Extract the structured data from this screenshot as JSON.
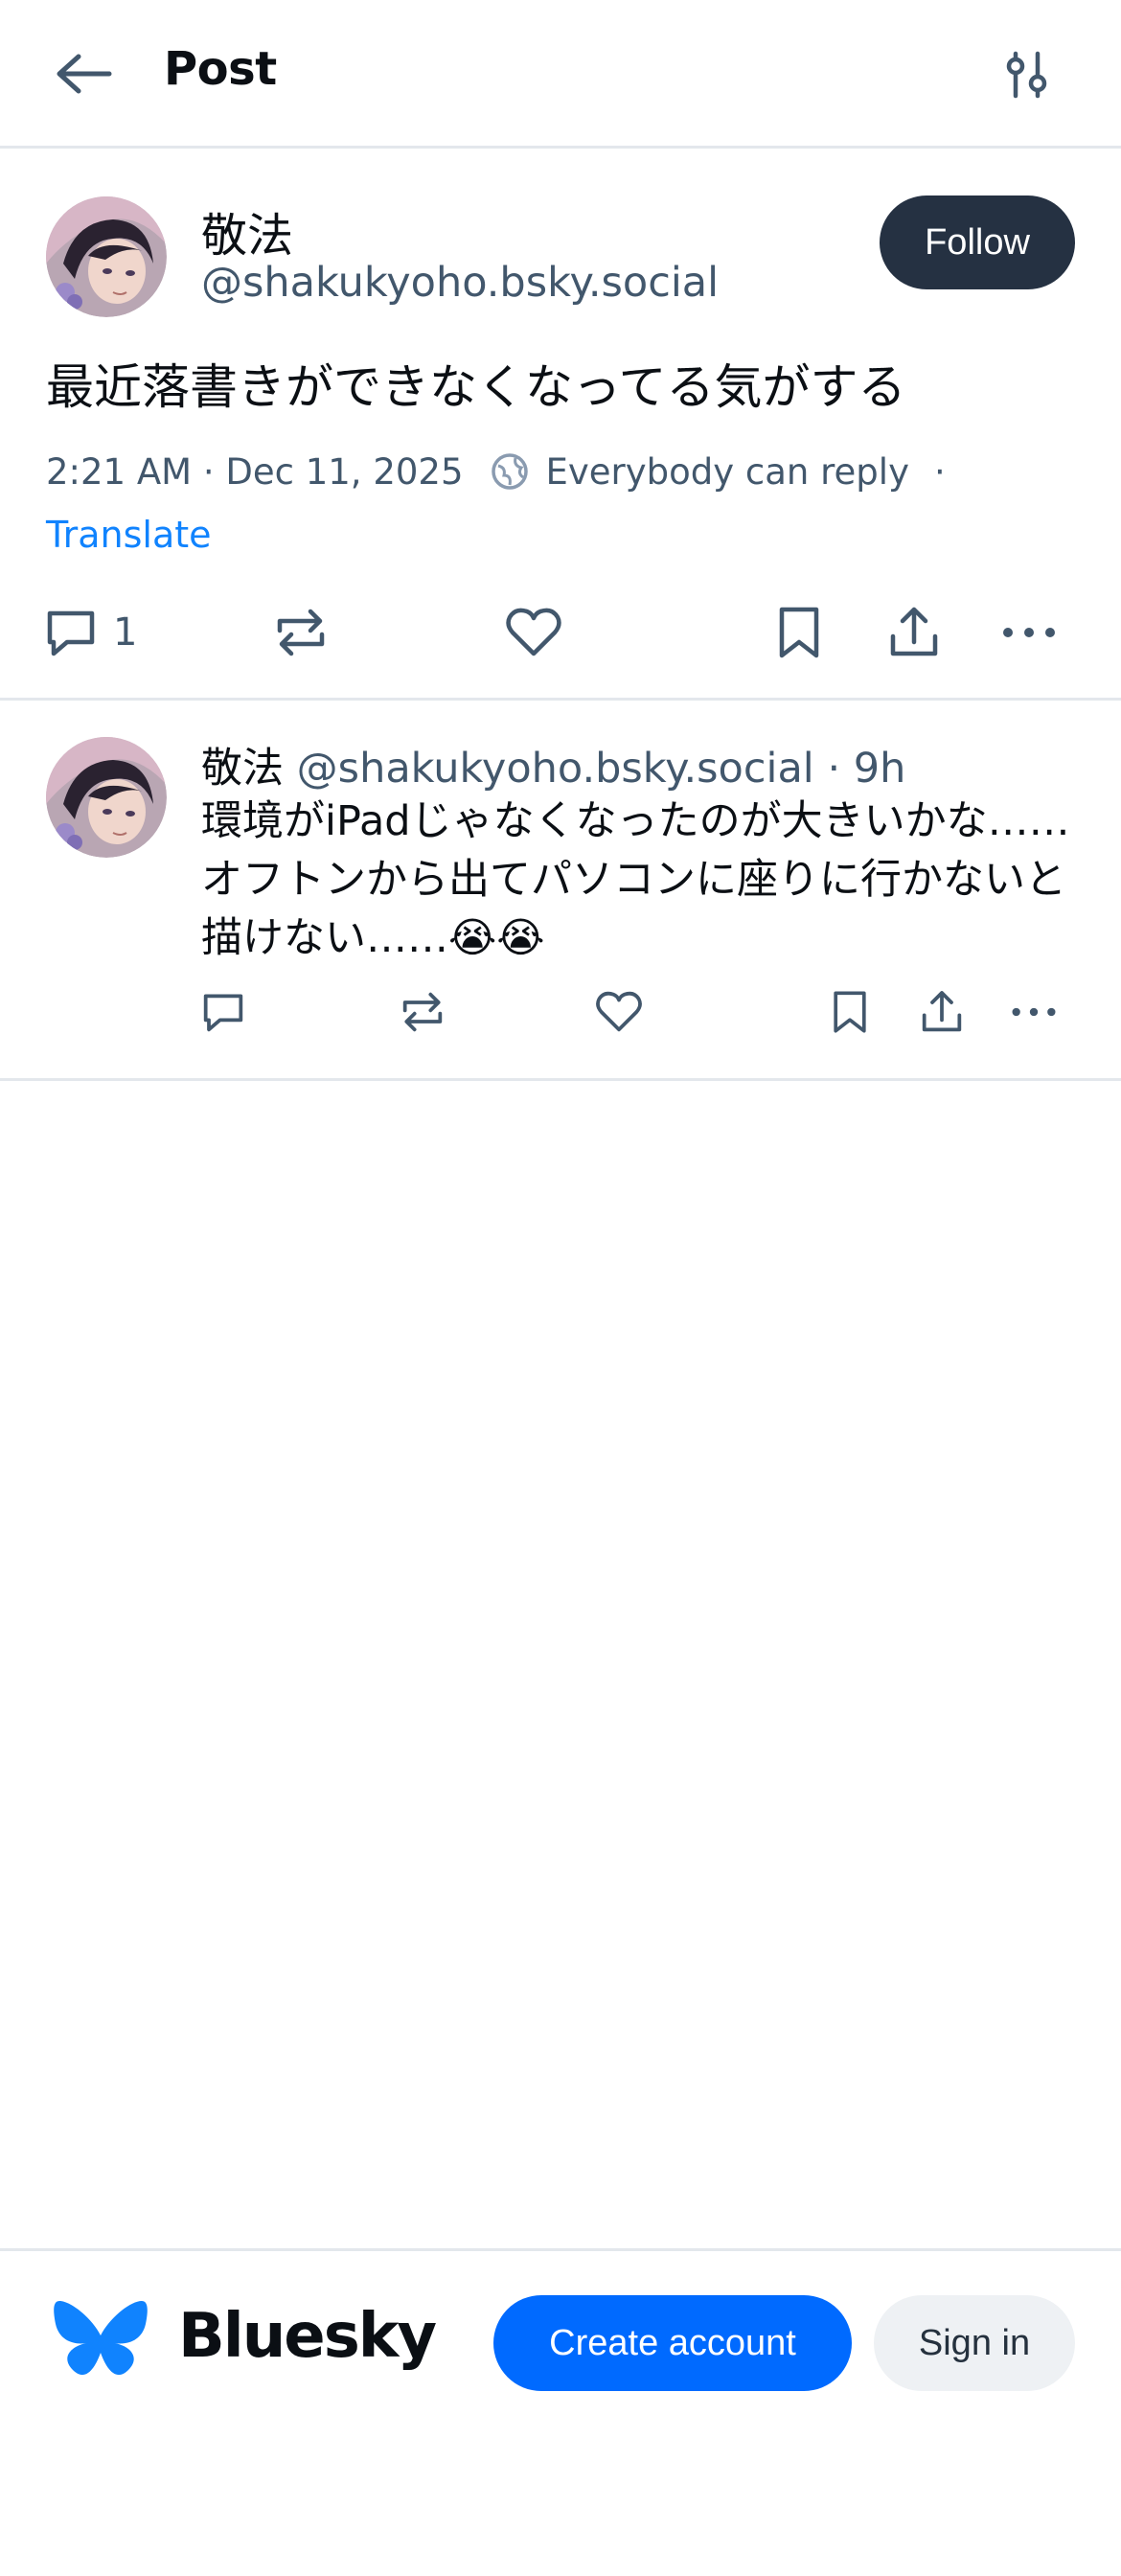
{
  "header": {
    "title": "Post",
    "back_icon": "arrow-left-icon",
    "settings_icon": "sliders-icon"
  },
  "main_post": {
    "author_name": "敬法",
    "author_handle": "@shakukyoho.bsky.social",
    "follow_label": "Follow",
    "text": "最近落書きができなくなってる気がする",
    "timestamp": "2:21 AM · Dec 11, 2025",
    "reply_setting": "Everybody can reply",
    "separator": "·",
    "translate_label": "Translate",
    "reply_count": "1"
  },
  "reply": {
    "author_name": "敬法",
    "author_handle": "@shakukyoho.bsky.social",
    "age": "· 9h",
    "text": "環境がiPadじゃなくなったのが大きいかな……オフトンから出てパソコンに座りに行かないと描けない……😭😭"
  },
  "footer": {
    "brand": "Bluesky",
    "create_account_label": "Create account",
    "sign_in_label": "Sign in"
  },
  "colors": {
    "primary": "#006aff",
    "text": "#0b0f14",
    "muted": "#42576c",
    "link": "#1083fe",
    "follow_bg": "#253142",
    "divider": "#e3e7ec"
  }
}
